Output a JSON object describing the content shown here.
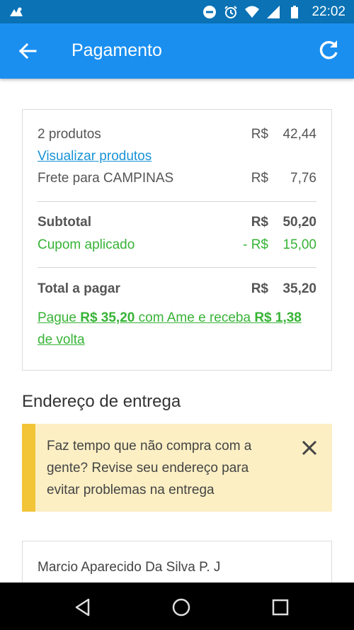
{
  "status_bar": {
    "time": "22:02",
    "icons": [
      "notification-icon",
      "do-not-disturb-icon",
      "alarm-icon",
      "wifi-icon",
      "signal-icon",
      "battery-icon"
    ]
  },
  "app_bar": {
    "title": "Pagamento",
    "back_icon": "arrow-left-icon",
    "refresh_icon": "refresh-icon"
  },
  "summary": {
    "products": {
      "label": "2 produtos",
      "currency": "R$",
      "amount": "42,44"
    },
    "view_products_link": "Visualizar produtos",
    "shipping": {
      "label": "Frete para CAMPINAS",
      "currency": "R$",
      "amount": "7,76"
    },
    "subtotal": {
      "label": "Subtotal",
      "currency": "R$",
      "amount": "50,20"
    },
    "coupon": {
      "label": "Cupom aplicado",
      "currency": "- R$",
      "amount": "15,00"
    },
    "total": {
      "label": "Total a pagar",
      "currency": "R$",
      "amount": "35,20"
    },
    "ame": {
      "prefix": "Pague ",
      "pay_amount": "R$ 35,20",
      "middle": " com Ame e receba ",
      "cashback": "R$ 1,38",
      "suffix": " de volta"
    }
  },
  "delivery": {
    "title": "Endereço de entrega",
    "warning": "Faz tempo que não compra com a gente? Revise seu endereço para evitar problemas na entrega",
    "recipient": "Marcio Aparecido Da Silva P. J"
  },
  "colors": {
    "status_bar": "#0a72b5",
    "app_bar": "#1a8ff0",
    "green": "#37b336",
    "link": "#1893d6",
    "warning_bg": "#fcefc4",
    "warning_bar": "#f2c438"
  }
}
